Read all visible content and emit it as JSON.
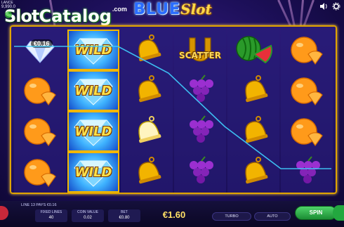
{
  "top_bar": {
    "balance_label": "LANCE",
    "balance_value": "9,990.0",
    "watermark_slot": "Slot",
    "watermark_catalog": "Catalog",
    "watermark_com": ".com",
    "logo_blue": "BLUE",
    "logo_slot": "Slot",
    "icons": [
      "sound-icon",
      "settings-icon"
    ]
  },
  "reels": {
    "win_badge": "€0.16",
    "wild_label": "WILD",
    "scatter_label": "SCATTER",
    "columns": [
      [
        "orange",
        "orange",
        "orange",
        "orange"
      ],
      [
        "wild",
        "wild",
        "wild",
        "wild"
      ],
      [
        "bell",
        "bell",
        "bell",
        "bell"
      ],
      [
        "scatter",
        "grapes",
        "grapes",
        "grapes"
      ],
      [
        "watermelon",
        "bell",
        "bell",
        "bell"
      ],
      [
        "orange",
        "orange",
        "orange",
        "grapes"
      ]
    ]
  },
  "bottom_bar": {
    "line_info": "LINE 13 PAYS €0.16",
    "fixed_lines_label": "FIXED LINES",
    "fixed_lines_value": "40",
    "coin_value_label": "COIN VALUE",
    "coin_value_value": "0.02",
    "bet_label": "BET",
    "bet_value": "€0.80",
    "win_amount": "€1.60",
    "turbo_label": "TURBO",
    "auto_label": "AUTO",
    "spin_label": "SPIN"
  },
  "colors": {
    "frame": "#e0a400",
    "background": "#1c0f58",
    "payline": "#3fd0ff",
    "spin_button": "#2ea84a",
    "win_text": "#ffe066"
  }
}
